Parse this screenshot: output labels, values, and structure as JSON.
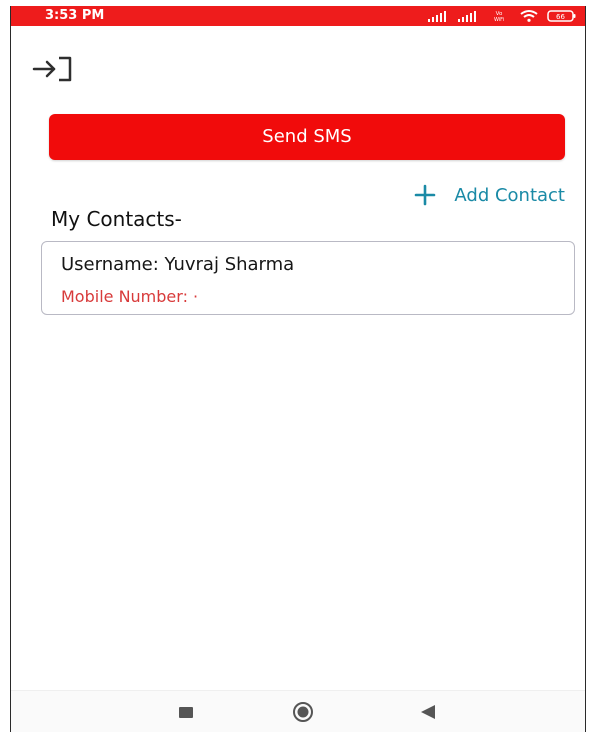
{
  "status_bar": {
    "time": "3:53 PM",
    "network_label": "Vo\nWiFi",
    "battery": "66",
    "background_color": "#ee1c1c"
  },
  "toolbar": {
    "login_icon": "login-arrow-icon"
  },
  "actions": {
    "send_sms_label": "Send SMS",
    "send_sms_color": "#f10b0b",
    "add_contact_label": "Add Contact",
    "add_contact_icon": "plus-icon",
    "add_contact_color": "#1a8aa6"
  },
  "contacts": {
    "heading": "My Contacts-",
    "items": [
      {
        "username": "Username: Yuvraj Sharma",
        "mobile": "Mobile Number: ·",
        "mobile_color": "#d83a3a"
      }
    ]
  },
  "navigation": {
    "recent_icon": "square-icon",
    "home_icon": "circle-home-icon",
    "back_icon": "triangle-back-icon"
  }
}
